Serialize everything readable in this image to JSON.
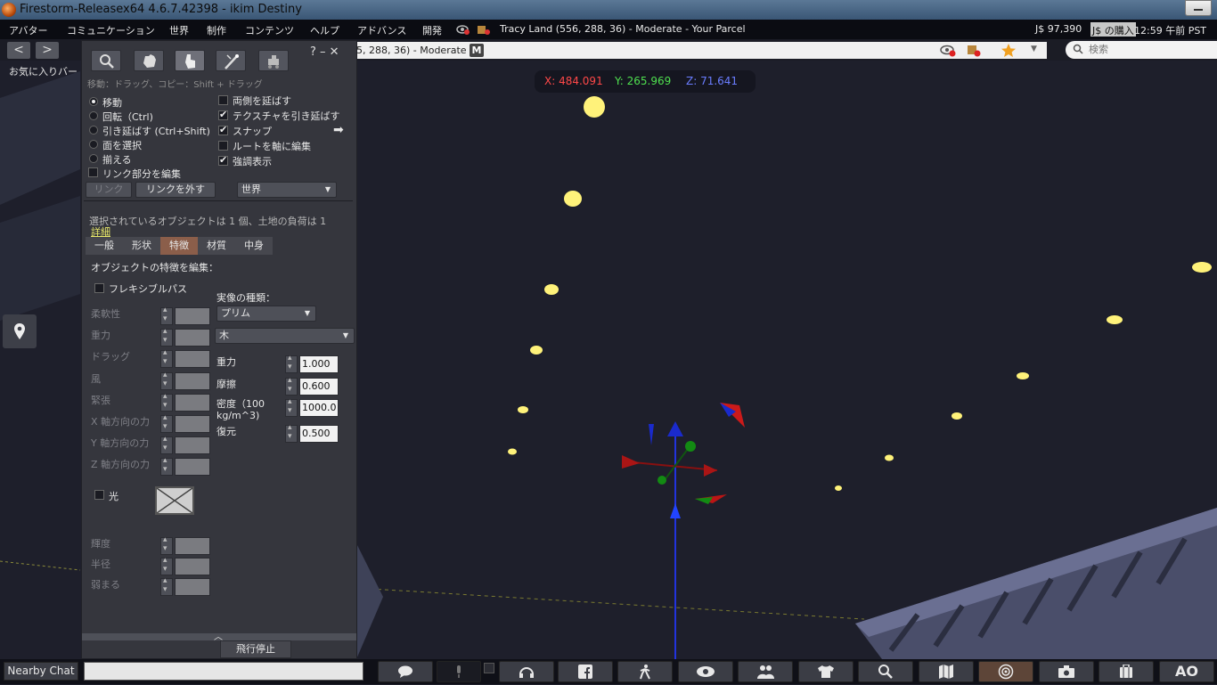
{
  "window": {
    "title": "Firestorm-Releasex64 4.6.7.42398 - ikim Destiny"
  },
  "menu": {
    "items": [
      "アバター",
      "コミュニケーション",
      "世界",
      "制作",
      "コンテンツ",
      "ヘルプ",
      "アドバンス",
      "開発"
    ],
    "location": "Tracy Land (556, 288, 36) - Moderate - Your Parcel",
    "balance": "J$ 97,390",
    "buy": "J$ の購入",
    "clock": "12:59 午前 PST"
  },
  "navbar": {
    "back": "<",
    "forward": ">",
    "location_text": "5, 288, 36) - Moderate",
    "maturity": "M",
    "search_placeholder": "検索"
  },
  "favorites_bar": "お気に入りバー",
  "coords": {
    "x": "X: 484.091",
    "y": "Y: 265.969",
    "z": "Z: 71.641"
  },
  "build": {
    "controls": "?  –  ✕",
    "hint": "移動：ドラッグ、コピー：Shift + ドラッグ",
    "modes": [
      "移動",
      "回転（Ctrl)",
      "引き延ばす (Ctrl+Shift)",
      "面を選択",
      "揃える"
    ],
    "edit_linked": "リンク部分を編集",
    "options": [
      "両側を延ばす",
      "テクスチャを引き延ばす",
      "スナップ",
      "ルートを軸に編集",
      "強調表示"
    ],
    "link_btn": "リンク",
    "unlink_btn": "リンクを外す",
    "ruler": "世界",
    "selection_info": "選択されているオブジェクトは 1 個、土地の負荷は 1",
    "details_link": "詳細",
    "tabs": [
      "一般",
      "形状",
      "特徴",
      "材質",
      "中身"
    ],
    "feature_title": "オブジェクトの特徴を編集：",
    "flexible": "フレキシブルパス",
    "flex_params": [
      "柔軟性",
      "重力",
      "ドラッグ",
      "風",
      "緊張",
      "X 軸方向の力",
      "Y 軸方向の力",
      "Z 軸方向の力"
    ],
    "physics_type_label": "実像の種類：",
    "physics_type": "プリム",
    "material": "木",
    "gravity_label": "重力",
    "gravity": "1.000",
    "friction_label": "摩擦",
    "friction": "0.600",
    "density_label": "密度（100 kg/m^3)",
    "density": "1000.0",
    "restitution_label": "復元",
    "restitution": "0.500",
    "light": "光",
    "light_params": [
      "輝度",
      "半径",
      "弱まる"
    ],
    "fly_stop": "飛行停止"
  },
  "bottom": {
    "nearby_chat": "Nearby Chat",
    "ao": "AO"
  },
  "colors": {
    "active_tab": "#8b5e4a",
    "coord_x": "#ff4848",
    "coord_y": "#4fe04f",
    "coord_z": "#6a7dff",
    "light_dot": "#fff27a"
  }
}
